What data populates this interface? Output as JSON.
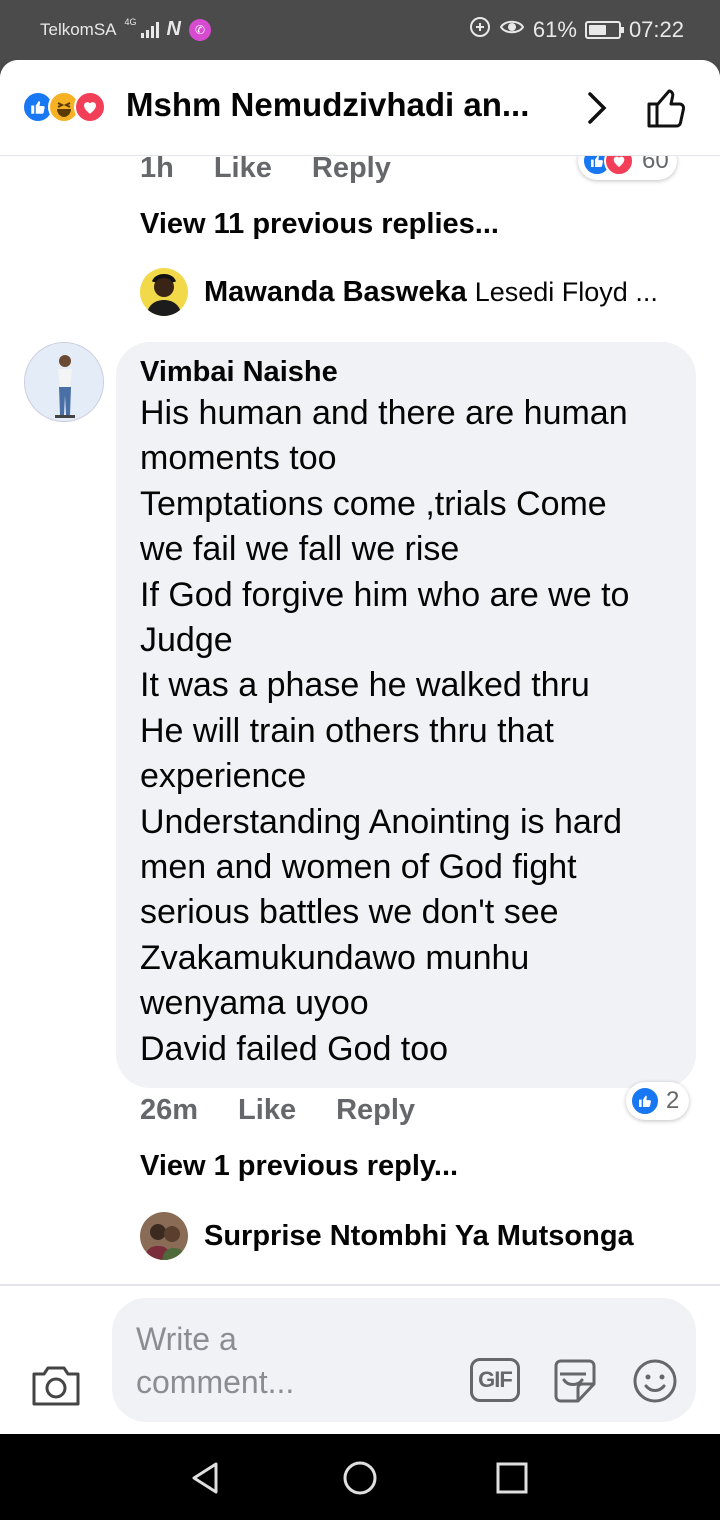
{
  "status_bar": {
    "carrier": "TelkomSA",
    "network": "4G",
    "battery": "61%",
    "time": "07:22"
  },
  "header": {
    "title": "Mshm Nemudzivhadi an...",
    "reaction_icons": [
      "like-icon",
      "haha-icon",
      "love-icon"
    ]
  },
  "previous_comment": {
    "time": "1h",
    "like_label": "Like",
    "reply_label": "Reply",
    "reaction_count": "60"
  },
  "thread1": {
    "view_replies": "View 11 previous replies...",
    "latest_reply_name": "Mawanda Basweka",
    "latest_reply_preview": "Lesedi Floyd ..."
  },
  "comment": {
    "author": "Vimbai Naishe",
    "lines": [
      "His human and there are human",
      "moments too",
      "Temptations come ,trials Come",
      "we fail we fall we rise",
      "If God forgive him who are we to",
      "Judge",
      "It was a phase he walked thru",
      "He will train others thru that",
      "experience",
      "Understanding Anointing is hard",
      "men and women of God fight",
      "serious battles we don't see",
      "Zvakamukundawo munhu",
      "wenyama uyoo",
      "David failed God too"
    ],
    "time": "26m",
    "like_label": "Like",
    "reply_label": "Reply",
    "reaction_count": "2"
  },
  "thread2": {
    "view_replies": "View 1 previous reply...",
    "latest_reply_name": "Surprise Ntombhi Ya Mutsonga"
  },
  "composer": {
    "placeholder": "Write a comment...",
    "gif_label": "GIF"
  },
  "colors": {
    "accent": "#1877f2",
    "love": "#f33e58",
    "haha": "#f7b125",
    "bubble": "#f0f2f5",
    "muted_text": "#65676b"
  }
}
